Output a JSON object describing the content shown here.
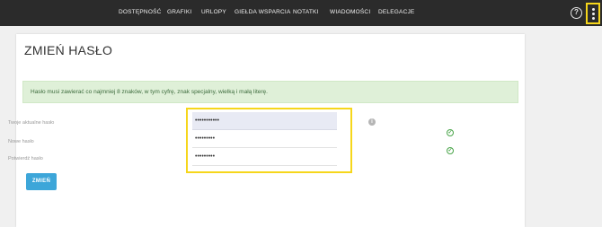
{
  "nav": {
    "items": [
      {
        "label": "DOSTĘPNOŚĆ"
      },
      {
        "label": "GRAFIKI"
      },
      {
        "label": "URLOPY"
      },
      {
        "label": "GIEŁDA WSPARCIA"
      },
      {
        "label": "NOTATKI"
      },
      {
        "label": "WIADOMOŚCI"
      },
      {
        "label": "DELEGACJE"
      }
    ],
    "help_icon_glyph": "?",
    "icons": [
      "help-icon",
      "kebab-menu-icon"
    ]
  },
  "page": {
    "title": "ZMIEŃ HASŁO",
    "alert_text": "Hasło musi zawierać co najmniej 8 znaków, w tym cyfrę, znak specjalny, wielką i małą literę.",
    "fields": [
      {
        "label": "Twoje aktualne hasło",
        "value": "•••••••••••"
      },
      {
        "label": "Nowe hasło",
        "value": "•••••••••"
      },
      {
        "label": "Potwierdź hasło",
        "value": "•••••••••"
      }
    ],
    "info_glyph": "i",
    "check_glyph": "✓",
    "submit_label": "ZMIEŃ"
  },
  "colors": {
    "topbar": "#2b2b2b",
    "highlight": "#f6d61b",
    "alert_bg": "#dff0d8",
    "button": "#3da6d9",
    "valid": "#4aa54a"
  }
}
